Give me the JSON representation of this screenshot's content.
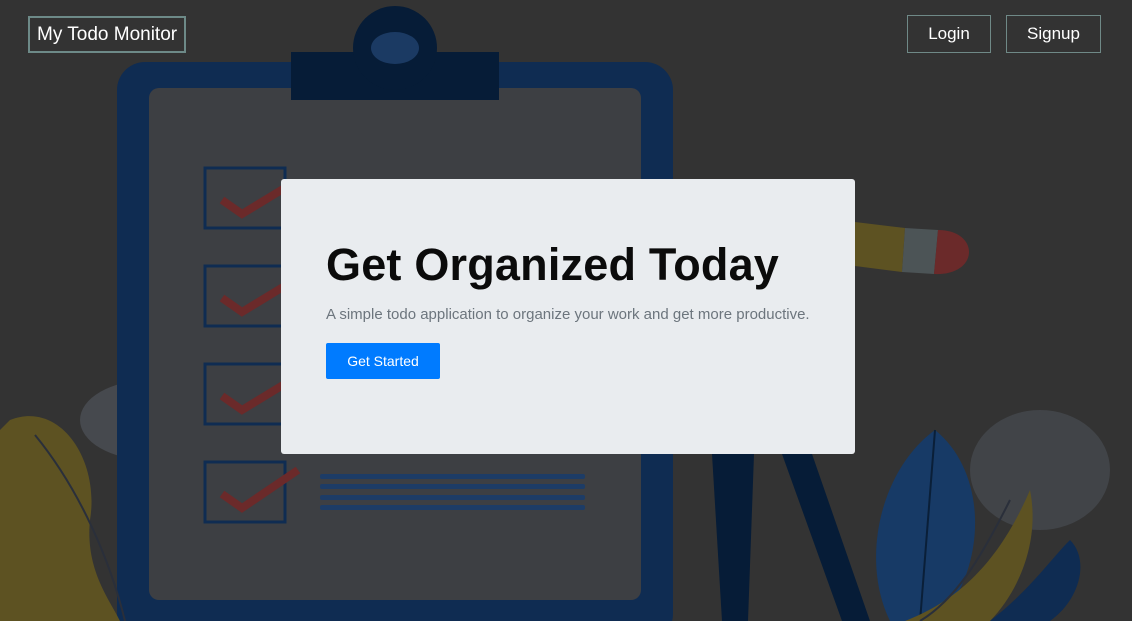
{
  "navbar": {
    "brand": "My Todo Monitor",
    "login_label": "Login",
    "signup_label": "Signup"
  },
  "hero": {
    "title": "Get Organized Today",
    "subtitle": "A simple todo application to organize your work and get more productive.",
    "cta_label": "Get Started"
  },
  "colors": {
    "overlay_background": "#333333",
    "hero_background": "#e9ecef",
    "primary_button": "#007bff",
    "nav_border": "#6f8987",
    "illustration_navy": "#0f2c52",
    "illustration_mustard": "#5d5222",
    "illustration_rust": "#6b2a2a"
  },
  "background_illustration": {
    "icons": [
      "clipboard-icon",
      "checkmark-icon",
      "pencil-icon",
      "leaf-icon",
      "person-legs-icon"
    ]
  }
}
